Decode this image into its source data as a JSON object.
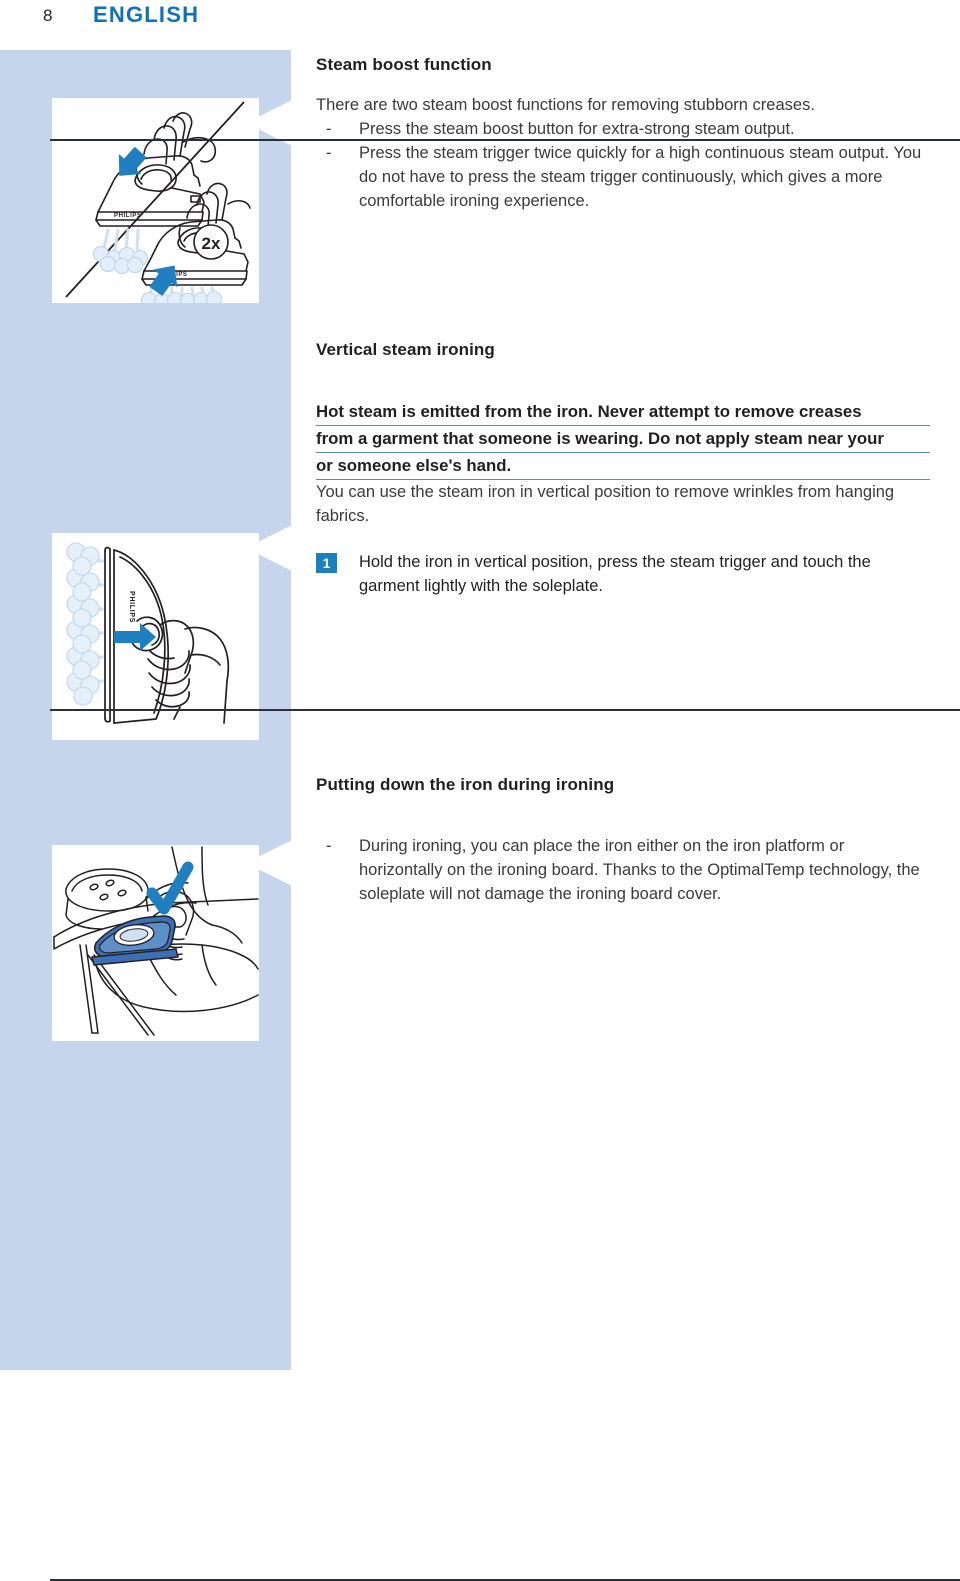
{
  "header": {
    "page_number": "8",
    "language": "ENGLISH"
  },
  "colors": {
    "panel_blue": "#c5d5ec",
    "accent_blue": "#0f72b5",
    "step_badge_blue": "#1c7fbe",
    "warning_underline": "#5d8ea7",
    "rule_dark": "#2b2f3a",
    "body_text": "#3b3b3b",
    "illustration_line": "#231f20",
    "steam_blue": "#cfe0f2",
    "arrow_blue": "#1f7fc0"
  },
  "sections": [
    {
      "id": "steam-boost",
      "title": "Steam boost function",
      "intro": "There are two steam boost functions for removing stubborn creases.",
      "bullets": [
        {
          "dash": "-",
          "text": "Press the steam boost button for extra-strong steam output."
        },
        {
          "dash": "-",
          "text": "Press the steam trigger twice quickly for a high continuous steam output. You do not have to press the steam trigger continuously, which gives a more comfortable ironing experience."
        }
      ],
      "illustration": {
        "name": "iron-steam-boost-illustration",
        "brand_label": "PHILIPS",
        "badge_label": "2x"
      }
    },
    {
      "id": "vertical-steam-ironing",
      "title": "Vertical steam ironing",
      "warning_lines": [
        "Hot steam is emitted from the iron. Never attempt to remove creases",
        "from a garment that someone is wearing. Do not apply steam near your",
        "or someone else's hand."
      ],
      "body": "You can use the steam iron in vertical position to remove wrinkles from hanging fabrics.",
      "step": {
        "number": "1",
        "text": "Hold the iron in vertical position, press the steam trigger and touch the garment lightly with the soleplate."
      },
      "illustration": {
        "name": "iron-vertical-steam-illustration",
        "brand_label": "PHILIPS"
      }
    },
    {
      "id": "putting-down-iron",
      "title": "Putting down the iron during ironing",
      "bullets": [
        {
          "dash": "-",
          "text": "During ironing, you can place the iron either on the iron platform or horizontally on the ironing board. Thanks to the OptimalTemp technology, the soleplate will not damage the ironing board cover."
        }
      ],
      "illustration": {
        "name": "iron-on-board-illustration",
        "check_mark": "checkmark"
      }
    }
  ]
}
